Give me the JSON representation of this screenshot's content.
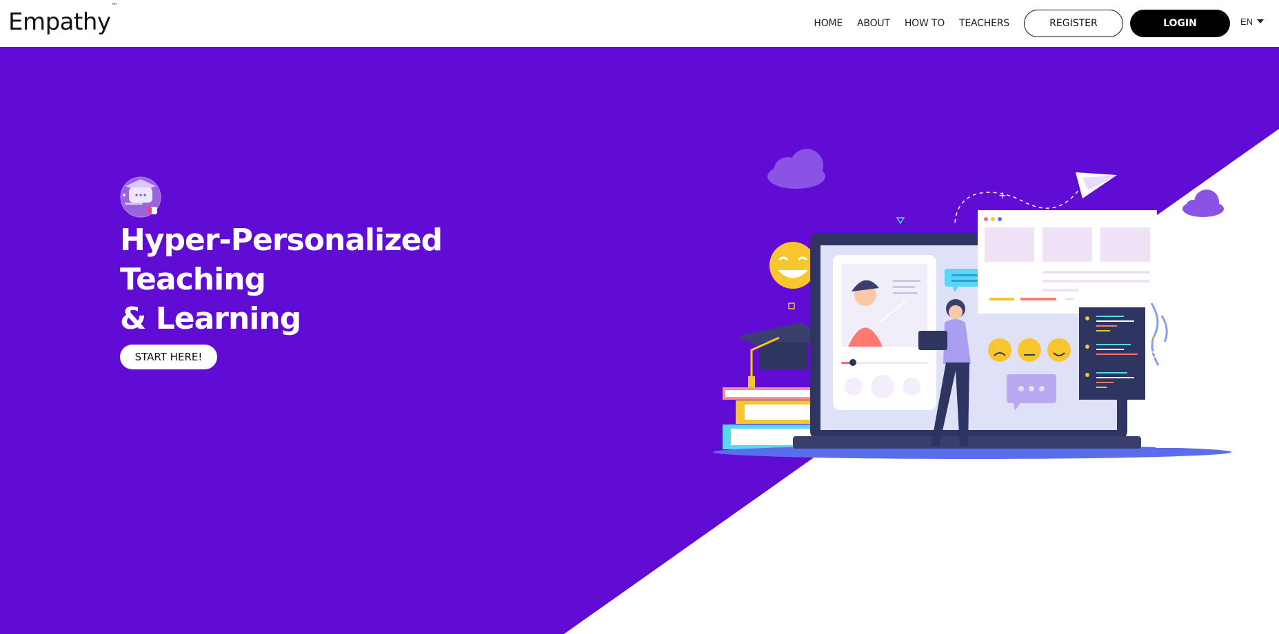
{
  "header": {
    "brand": "Empathy",
    "brand_tm": "™",
    "nav": [
      "HOME",
      "ABOUT",
      "HOW TO",
      "TEACHERS"
    ],
    "register_label": "REGISTER",
    "login_label": "LOGIN",
    "language": "EN"
  },
  "hero": {
    "title_line1": "Hyper-Personalized Teaching",
    "title_line2": "& Learning",
    "cta_label": "START HERE!"
  },
  "colors": {
    "hero_purple": "#600cd4",
    "accent_yellow": "#f7c52c",
    "dark_navy": "#2e3560"
  }
}
